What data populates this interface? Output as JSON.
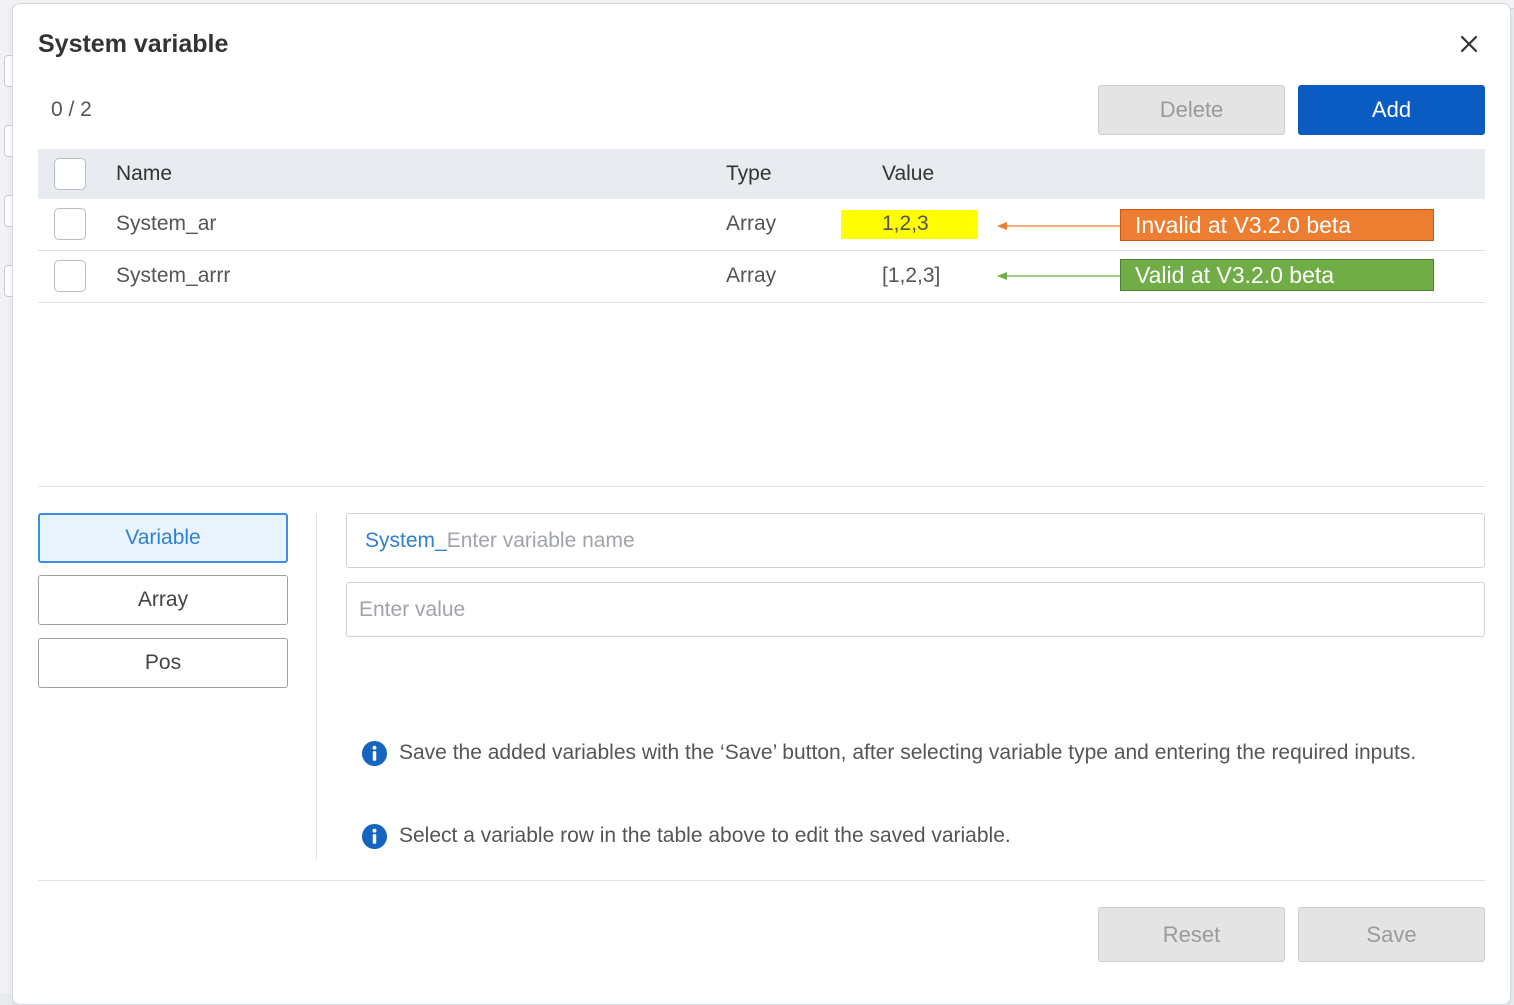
{
  "dialog": {
    "title": "System variable",
    "selection_count": "0 / 2"
  },
  "toolbar": {
    "delete_label": "Delete",
    "add_label": "Add"
  },
  "table": {
    "headers": {
      "name": "Name",
      "type": "Type",
      "value": "Value"
    },
    "rows": [
      {
        "name": "System_ar",
        "type": "Array",
        "value": "1,2,3"
      },
      {
        "name": "System_arrr",
        "type": "Array",
        "value": "[1,2,3]"
      }
    ]
  },
  "annotations": {
    "invalid": {
      "text": "Invalid  at V3.2.0 beta",
      "color": "#ed7d31"
    },
    "valid": {
      "text": "Valid  at V3.2.0 beta",
      "color": "#70ad47"
    },
    "highlight_color": "#ffff00"
  },
  "type_selector": {
    "items": [
      "Variable",
      "Array",
      "Pos"
    ],
    "selected": "Variable"
  },
  "form": {
    "name_prefix": "System_",
    "name_placeholder": "Enter variable name",
    "value_placeholder": "Enter value"
  },
  "info": [
    "Save the added variables with the ‘Save’ button, after selecting variable type and entering the required inputs.",
    "Select a variable row in the table above to edit the saved variable."
  ],
  "footer": {
    "reset_label": "Reset",
    "save_label": "Save"
  },
  "colors": {
    "accent": "#0a5cc2",
    "selected_tab": "#3d8ee6",
    "info_icon": "#1565c0"
  }
}
